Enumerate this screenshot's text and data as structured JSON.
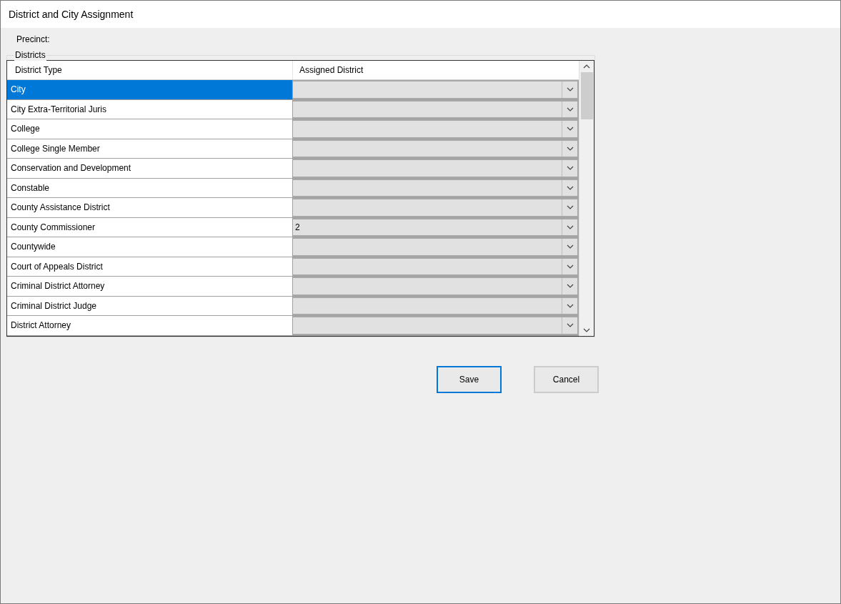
{
  "window": {
    "title": "District and City Assignment"
  },
  "precinct": {
    "label": "Precinct:"
  },
  "districts": {
    "legend": "Districts",
    "columns": [
      "District Type",
      "Assigned District"
    ],
    "rows": [
      {
        "type": "City",
        "selected": true
      },
      {
        "type": "City Extra-Territorial Juris",
        "selected": false
      },
      {
        "type": "College",
        "selected": false
      },
      {
        "type": "College Single Member",
        "selected": false
      },
      {
        "type": "Conservation and Development",
        "selected": false
      },
      {
        "type": "Constable",
        "selected": false
      },
      {
        "type": "County Assistance District",
        "selected": false
      },
      {
        "type": "County Commissioner",
        "assigned": "2",
        "selected": false
      },
      {
        "type": "Countywide",
        "selected": false
      },
      {
        "type": "Court of Appeals District",
        "selected": false
      },
      {
        "type": "Criminal District Attorney",
        "selected": false
      },
      {
        "type": "Criminal District Judge",
        "selected": false
      },
      {
        "type": "District Attorney",
        "selected": false
      }
    ]
  },
  "buttons": [
    {
      "label": "Save",
      "focused": true
    },
    {
      "label": "Cancel",
      "focused": false
    }
  ]
}
